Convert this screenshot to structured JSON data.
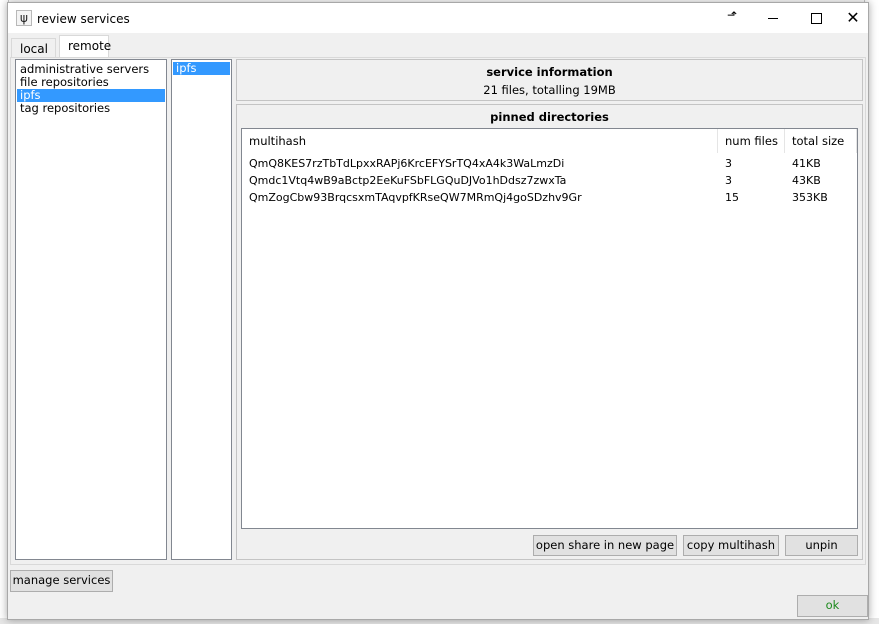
{
  "window": {
    "title": "review services",
    "app_icon_glyph": "ψ",
    "controls": {
      "minimize": "minimize-icon",
      "maximize": "maximize-icon",
      "close": "✕"
    }
  },
  "tabs": [
    {
      "label": "local",
      "selected": false
    },
    {
      "label": "remote",
      "selected": true
    }
  ],
  "service_types": [
    {
      "label": "administrative servers",
      "selected": false
    },
    {
      "label": "file repositories",
      "selected": false
    },
    {
      "label": "ipfs",
      "selected": true
    },
    {
      "label": "tag repositories",
      "selected": false
    }
  ],
  "services": [
    {
      "label": "ipfs",
      "selected": true
    }
  ],
  "service_information": {
    "title": "service information",
    "summary": "21 files, totalling 19MB"
  },
  "pinned_directories": {
    "title": "pinned directories",
    "columns": [
      "multihash",
      "num files",
      "total size"
    ],
    "rows": [
      {
        "multihash": "QmQ8KES7rzTbTdLpxxRAPj6KrcEFYSrTQ4xA4k3WaLmzDi",
        "num_files": "3",
        "total_size": "41KB"
      },
      {
        "multihash": "Qmdc1Vtq4wB9aBctp2EeKuFSbFLGQuDJVo1hDdsz7zwxTa",
        "num_files": "3",
        "total_size": "43KB"
      },
      {
        "multihash": "QmZogCbw93BrqcsxmTAqvpfKRseQW7MRmQj4goSDzhv9Gr",
        "num_files": "15",
        "total_size": "353KB"
      }
    ],
    "buttons": {
      "open_share": "open share in new page",
      "copy_multihash": "copy multihash",
      "unpin": "unpin"
    }
  },
  "footer": {
    "manage_services": "manage services",
    "ok": "ok"
  },
  "colors": {
    "selection": "#3399ff",
    "ok_text": "#1d8a1d",
    "dialog_bg": "#f0f0f0"
  }
}
